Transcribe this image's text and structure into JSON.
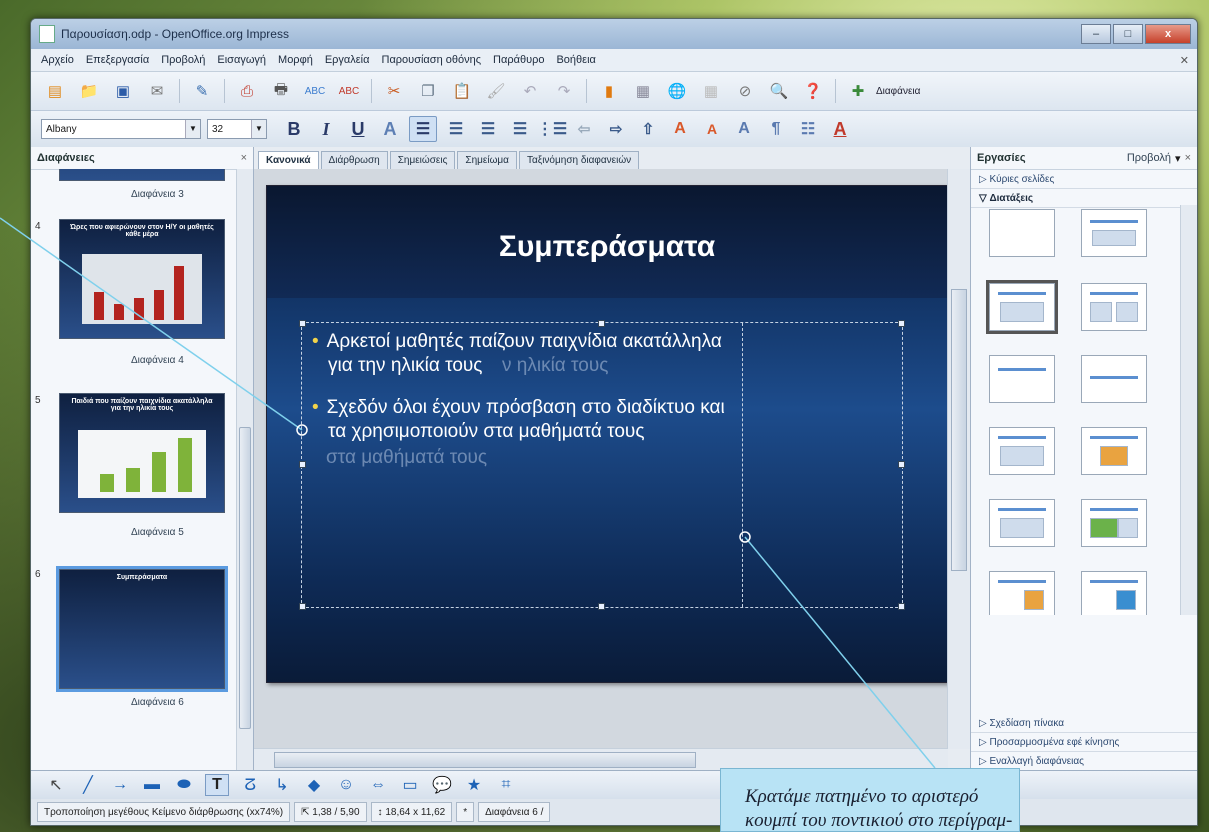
{
  "window": {
    "title": "Παρουσίαση.odp - OpenOffice.org Impress",
    "buttons": [
      "–",
      "□",
      "x"
    ]
  },
  "menubar": [
    "Αρχείο",
    "Επεξεργασία",
    "Προβολή",
    "Εισαγωγή",
    "Μορφή",
    "Εργαλεία",
    "Παρουσίαση οθόνης",
    "Παράθυρο",
    "Βοήθεια"
  ],
  "toolbar": {
    "icons": [
      "new-icon",
      "open-icon",
      "save-icon",
      "email-icon",
      "edit-file-icon",
      "export-pdf-icon",
      "print-icon",
      "spellcheck-icon",
      "autospell-icon",
      "cut-icon",
      "copy-icon",
      "paste-icon",
      "format-paintbrush-icon",
      "undo-icon",
      "redo-icon",
      "chart-icon",
      "table-icon",
      "hyperlink-icon",
      "grid-icon",
      "navigator-icon",
      "zoom-icon",
      "help-icon"
    ],
    "slide_label": "Διαφάνεια"
  },
  "format": {
    "font_name": "Albany",
    "font_size": "32",
    "buttons": [
      "B",
      "I",
      "U",
      "A"
    ]
  },
  "slides_pane": {
    "header": "Διαφάνειες",
    "close": "×",
    "slides": [
      {
        "num": "",
        "label": "Διαφάνεια 3",
        "title": ""
      },
      {
        "num": "4",
        "label": "Διαφάνεια 4",
        "title": "Ώρες που αφιερώνουν στον Η/Υ οι μαθητές κάθε μέρα"
      },
      {
        "num": "5",
        "label": "Διαφάνεια 5",
        "title": "Παιδιά που παίζουν παιχνίδια ακατάλληλα για την ηλικία τους"
      },
      {
        "num": "6",
        "label": "Διαφάνεια 6",
        "title": "Συμπεράσματα"
      }
    ]
  },
  "view_tabs": [
    "Κανονικά",
    "Διάρθρωση",
    "Σημειώσεις",
    "Σημείωμα",
    "Ταξινόμηση διαφανειών"
  ],
  "slide": {
    "title": "Συμπεράσματα",
    "bullet1_line1": "Αρκετοί μαθητές παίζουν παιχνίδια ακατάλληλα",
    "bullet1_line2": "για την ηλικία τους",
    "bullet1_ghost": "ν ηλικία τους",
    "bullet2_line1": "Σχεδόν όλοι έχουν πρόσβαση στο διαδίκτυο και",
    "bullet2_line2": "τα χρησιμοποιούν στα μαθήματά τους",
    "bullet2_ghost": "στα μαθήματά τους"
  },
  "tasks_pane": {
    "header": "Εργασίες",
    "view": "Προβολή",
    "sections_top": [
      "Κύριες σελίδες",
      "Διατάξεις"
    ],
    "sections_bottom": [
      "Σχεδίαση πίνακα",
      "Προσαρμοσμένα εφέ κίνησης",
      "Εναλλαγή διαφάνειας"
    ]
  },
  "statusbar": {
    "message": "Τροποποίηση μεγέθους Κείμενο διάρθρωσης (xx74%)",
    "position": "1,38 / 5,90",
    "size": "18,64 x 11,62",
    "slide": "Διαφάνεια 6 /"
  },
  "callout": {
    "line1": "Κρατάμε πατημένο το αριστερό",
    "line2": "κουμπί του ποντικιού στο περίγραμ-"
  }
}
